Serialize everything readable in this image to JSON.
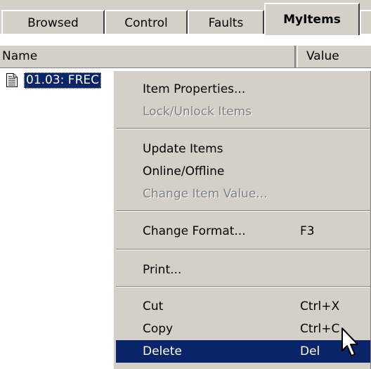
{
  "tabs": [
    {
      "label": "Browsed"
    },
    {
      "label": "Control"
    },
    {
      "label": "Faults"
    },
    {
      "label": "MyItems"
    }
  ],
  "columns": {
    "name": "Name",
    "value": "Value"
  },
  "list": {
    "items": [
      {
        "name": "01.03: FREC",
        "icon": "document-icon",
        "selected": true
      }
    ]
  },
  "context_menu": {
    "items": [
      {
        "label": "Item Properties...",
        "disabled": false
      },
      {
        "label": "Lock/Unlock Items",
        "disabled": true
      },
      {
        "label": "Update Items",
        "disabled": false
      },
      {
        "label": "Online/Offline",
        "disabled": false
      },
      {
        "label": "Change Item Value...",
        "disabled": true
      },
      {
        "label": "Change Format...",
        "shortcut": "F3",
        "disabled": false
      },
      {
        "label": "Print...",
        "disabled": false
      },
      {
        "label": "Cut",
        "shortcut": "Ctrl+X",
        "disabled": false
      },
      {
        "label": "Copy",
        "shortcut": "Ctrl+C",
        "disabled": false
      },
      {
        "label": "Delete",
        "shortcut": "Del",
        "disabled": false,
        "highlighted": true
      }
    ]
  },
  "colors": {
    "face": "#d4d0c8",
    "highlight": "#0a246a",
    "disabled_text": "#808080"
  },
  "cursor": {
    "icon": "arrow-pointer-icon"
  }
}
